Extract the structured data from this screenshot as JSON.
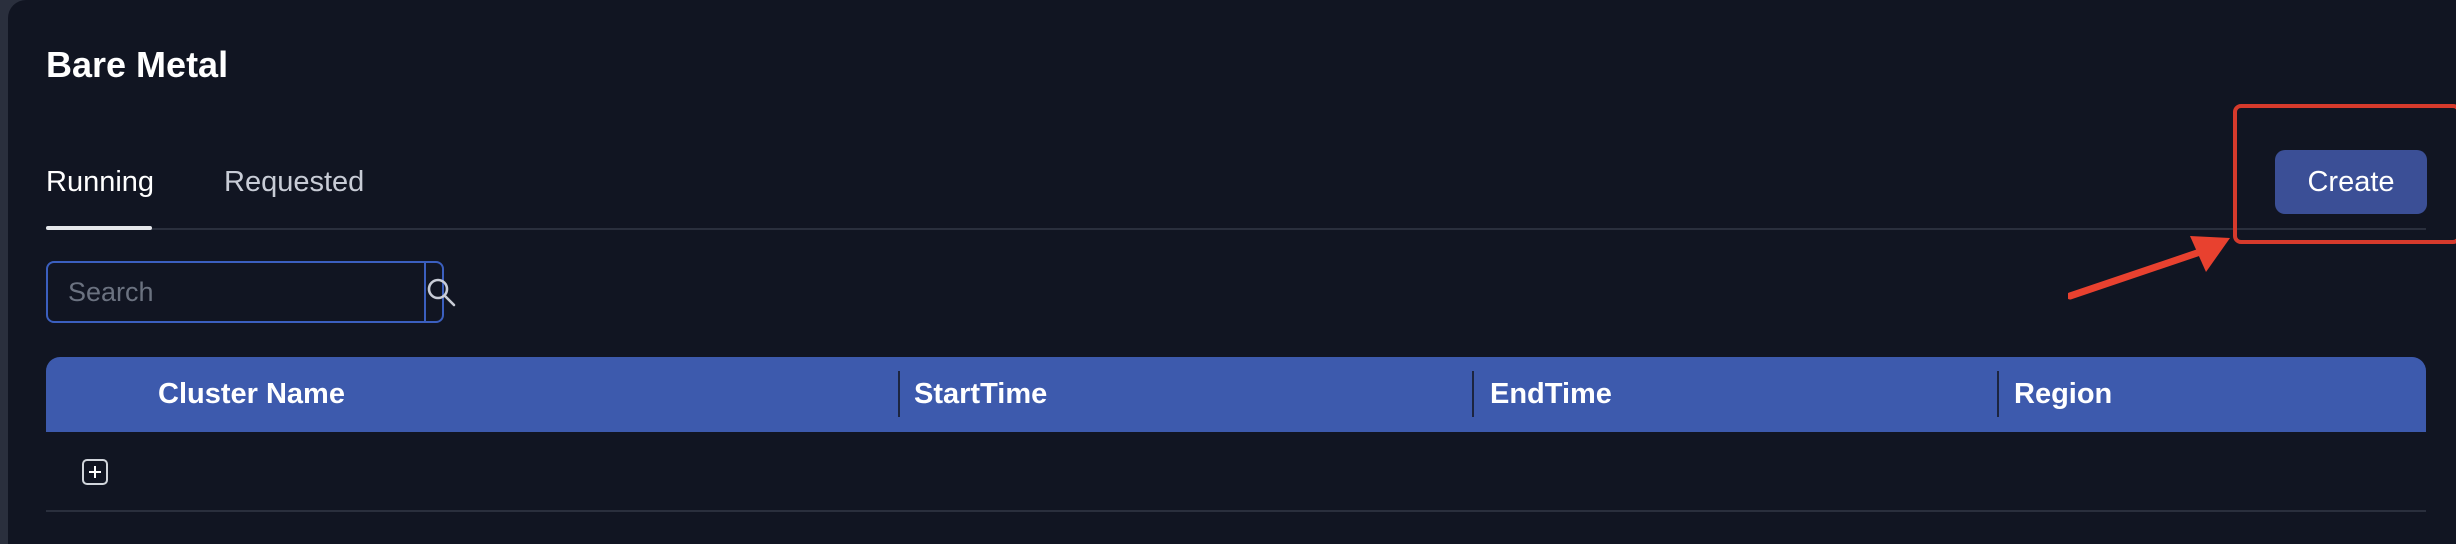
{
  "page": {
    "title": "Bare Metal"
  },
  "tabs": [
    {
      "label": "Running",
      "active": true
    },
    {
      "label": "Requested",
      "active": false
    }
  ],
  "actions": {
    "create_label": "Create"
  },
  "search": {
    "placeholder": "Search",
    "value": "",
    "icon": "search-icon"
  },
  "table": {
    "columns": [
      "Cluster Name",
      "StartTime",
      "EndTime",
      "Region"
    ],
    "rows": [
      {
        "expand_icon": "plus-icon",
        "cells": [
          "",
          "",
          "",
          ""
        ]
      }
    ]
  },
  "colors": {
    "background": "#111522",
    "accent": "#3d5aad",
    "button": "#3b4f96",
    "annotation": "#d63a2c"
  }
}
